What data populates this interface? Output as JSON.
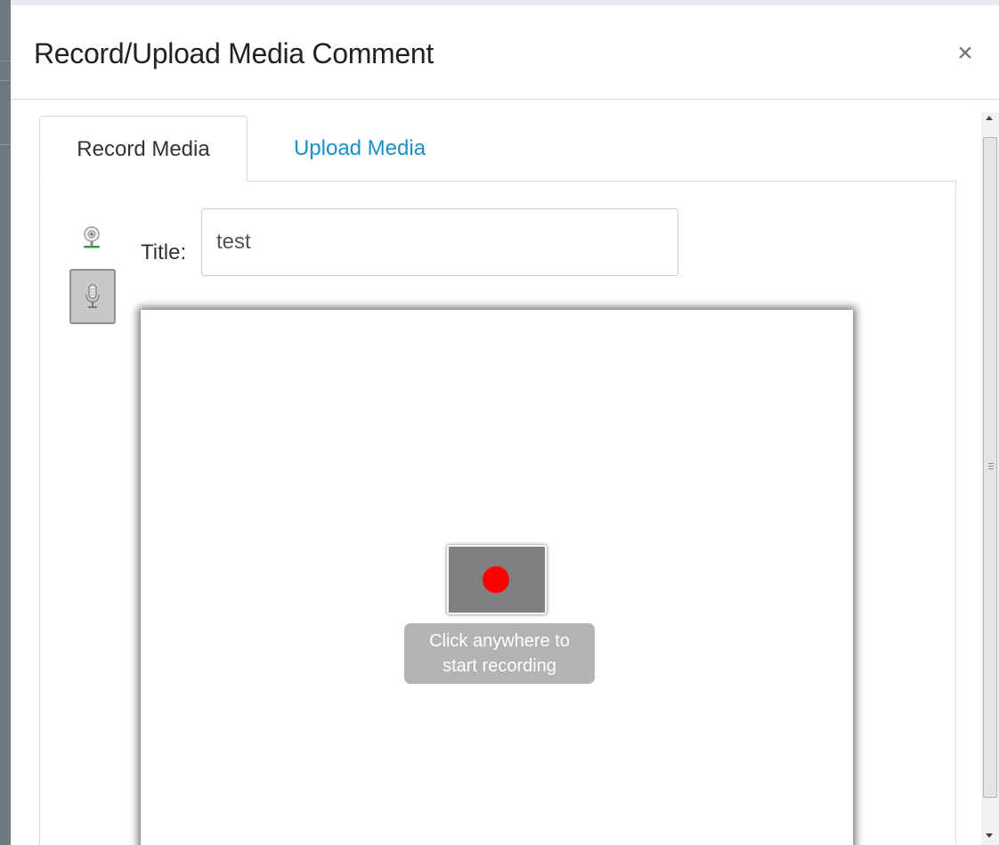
{
  "dialog": {
    "title": "Record/Upload Media Comment",
    "close_label": "×"
  },
  "tabs": [
    {
      "label": "Record Media",
      "active": true
    },
    {
      "label": "Upload Media",
      "active": false
    }
  ],
  "form": {
    "title_label": "Title:",
    "title_value": "test"
  },
  "devices": {
    "webcam_icon": "webcam-icon",
    "mic_icon": "microphone-icon",
    "selected": "microphone"
  },
  "recorder": {
    "hint_line1": "Click anywhere to",
    "hint_line2": "start recording",
    "record_icon": "record-dot-icon"
  },
  "colors": {
    "link": "#1a8fc7",
    "record_dot": "#ff0000",
    "record_button_bg": "#808080",
    "hint_bg": "#b3b3b3"
  }
}
